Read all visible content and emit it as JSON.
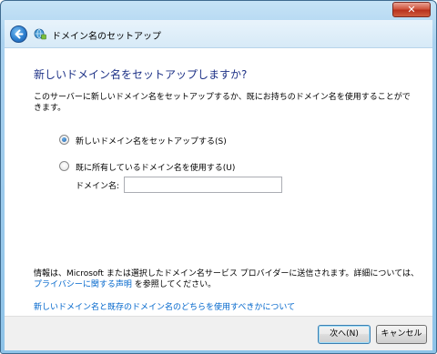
{
  "window": {
    "close_label": "✕"
  },
  "header": {
    "title": "ドメイン名のセットアップ"
  },
  "main": {
    "heading": "新しいドメイン名をセットアップしますか?",
    "description": "このサーバーに新しいドメイン名をセットアップするか、既にお持ちのドメイン名を使用することができます。",
    "options": [
      {
        "label": "新しいドメイン名をセットアップする(S)",
        "checked": true
      },
      {
        "label": "既に所有しているドメイン名を使用する(U)",
        "checked": false
      }
    ],
    "domain_field": {
      "label": "ドメイン名:",
      "value": ""
    },
    "info": {
      "prefix": "情報は、Microsoft または選択したドメイン名サービス プロバイダーに送信されます。詳細については、",
      "link": "プライバシーに関する声明",
      "suffix": " を参照してください。"
    },
    "help_link": "新しいドメイン名と既存のドメイン名のどちらを使用すべきかについて"
  },
  "footer": {
    "next_label": "次へ(N)",
    "cancel_label": "キャンセル"
  }
}
